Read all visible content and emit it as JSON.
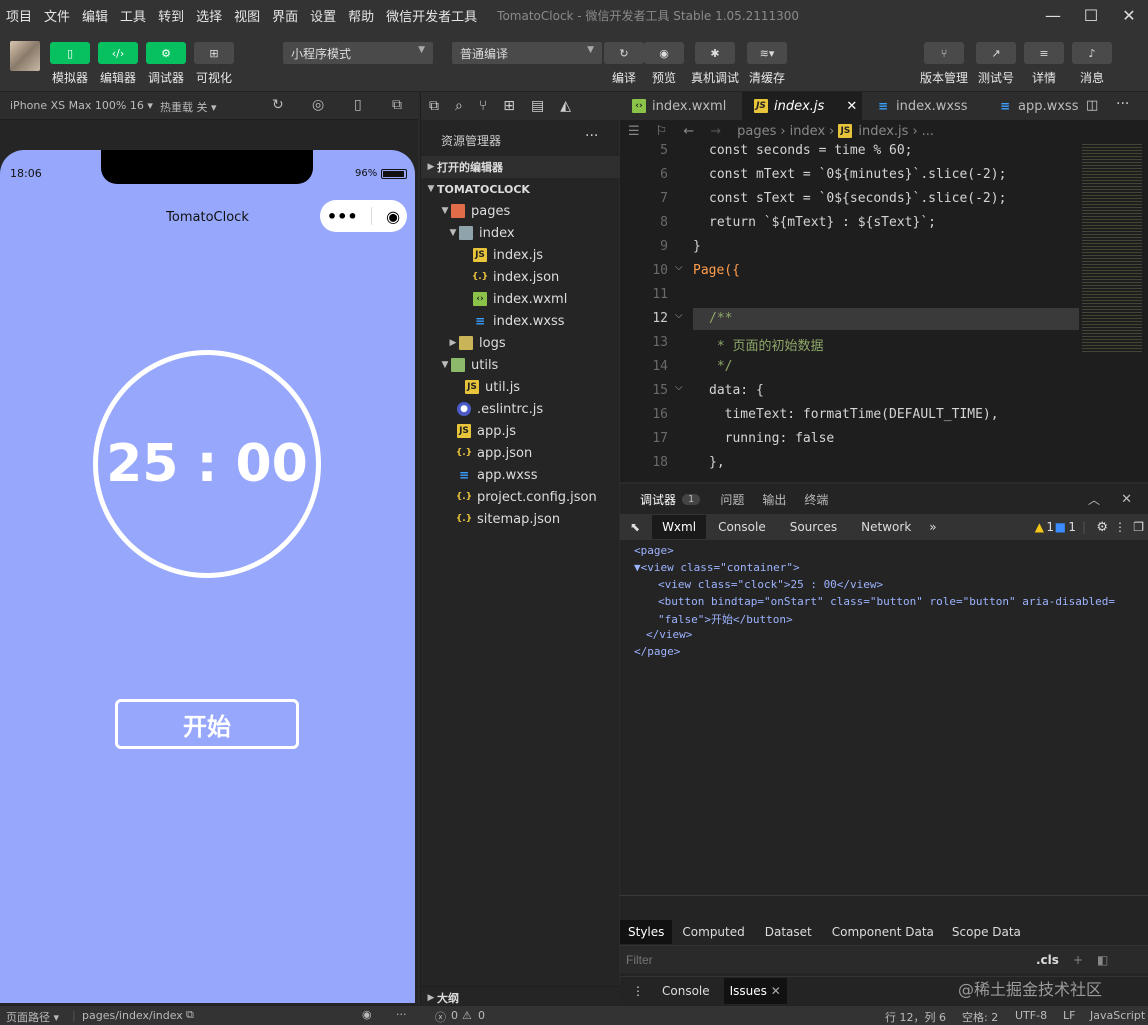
{
  "menubar": {
    "items": [
      "项目",
      "文件",
      "编辑",
      "工具",
      "转到",
      "选择",
      "视图",
      "界面",
      "设置",
      "帮助",
      "微信开发者工具"
    ],
    "title": "TomatoClock - 微信开发者工具 Stable 1.05.2111300"
  },
  "toolbar": {
    "simulator": "模拟器",
    "editor": "编辑器",
    "debugger": "调试器",
    "visual": "可视化",
    "mode_select": "小程序模式",
    "compile_select": "普通编译",
    "compile": "编译",
    "preview": "预览",
    "remote_debug": "真机调试",
    "clear_cache": "清缓存",
    "version": "版本管理",
    "test_account": "测试号",
    "details": "详情",
    "messages": "消息"
  },
  "simbar": {
    "device": "iPhone XS Max 100% 16",
    "hot_reload": "热重载 关"
  },
  "phone": {
    "time": "18:06",
    "battery": "96%",
    "nav_title": "TomatoClock",
    "clock": "25 : 00",
    "start": "开始"
  },
  "explorer": {
    "title": "资源管理器",
    "open_editors": "打开的编辑器",
    "project": "TOMATOCLOCK",
    "outline": "大纲",
    "files": [
      "pages",
      "index",
      "index.js",
      "index.json",
      "index.wxml",
      "index.wxss",
      "logs",
      "utils",
      "util.js",
      ".eslintrc.js",
      "app.js",
      "app.json",
      "app.wxss",
      "project.config.json",
      "sitemap.json"
    ]
  },
  "tabs": [
    "index.wxml",
    "index.js",
    "index.wxss",
    "app.wxss"
  ],
  "breadcrumb": [
    "pages",
    "index",
    "index.js",
    "..."
  ],
  "code": {
    "line_numbers": [
      "5",
      "6",
      "7",
      "8",
      "9",
      "10",
      "11",
      "12",
      "13",
      "14",
      "15",
      "16",
      "17",
      "18"
    ],
    "l5": "const seconds = time % 60;",
    "l6": "const mText = `0${minutes}`.slice(-2);",
    "l7": "const sText = `0${seconds}`.slice(-2);",
    "l8": "return `${mText} : ${sText}`;",
    "l9": "}",
    "l10": "Page({",
    "l12": "/**",
    "l13": " * 页面的初始数据",
    "l14": " */",
    "l15": "data: {",
    "l16": "  timeText: formatTime(DEFAULT_TIME),",
    "l17": "  running: false",
    "l18": "},"
  },
  "debug": {
    "tabs": [
      "调试器",
      "问题",
      "输出",
      "终端"
    ],
    "badge": "1",
    "devtools_tabs": [
      "Wxml",
      "Console",
      "Sources",
      "Network"
    ],
    "warn_count": "1",
    "info_count": "1",
    "xml": {
      "l1": "<page>",
      "l2": "▼<view class=\"container\">",
      "l3": "<view class=\"clock\">25 : 00</view>",
      "l4": "<button bindtap=\"onStart\" class=\"button\" role=\"button\" aria-disabled=",
      "l5": "\"false\">开始</button>",
      "l6": "</view>",
      "l7": "</page>"
    },
    "style_tabs": [
      "Styles",
      "Computed",
      "Dataset",
      "Component Data",
      "Scope Data"
    ],
    "filter": "Filter",
    "cls": ".cls",
    "drawer_tabs": [
      "Console",
      "Issues"
    ]
  },
  "status": {
    "path_label": "页面路径",
    "path": "pages/index/index",
    "errors": "0",
    "warnings": "0",
    "cursor": "行 12，列 6",
    "spaces": "空格: 2",
    "encoding": "UTF-8",
    "eol": "LF",
    "lang": "JavaScript",
    "watermark": "@稀土掘金技术社区"
  }
}
